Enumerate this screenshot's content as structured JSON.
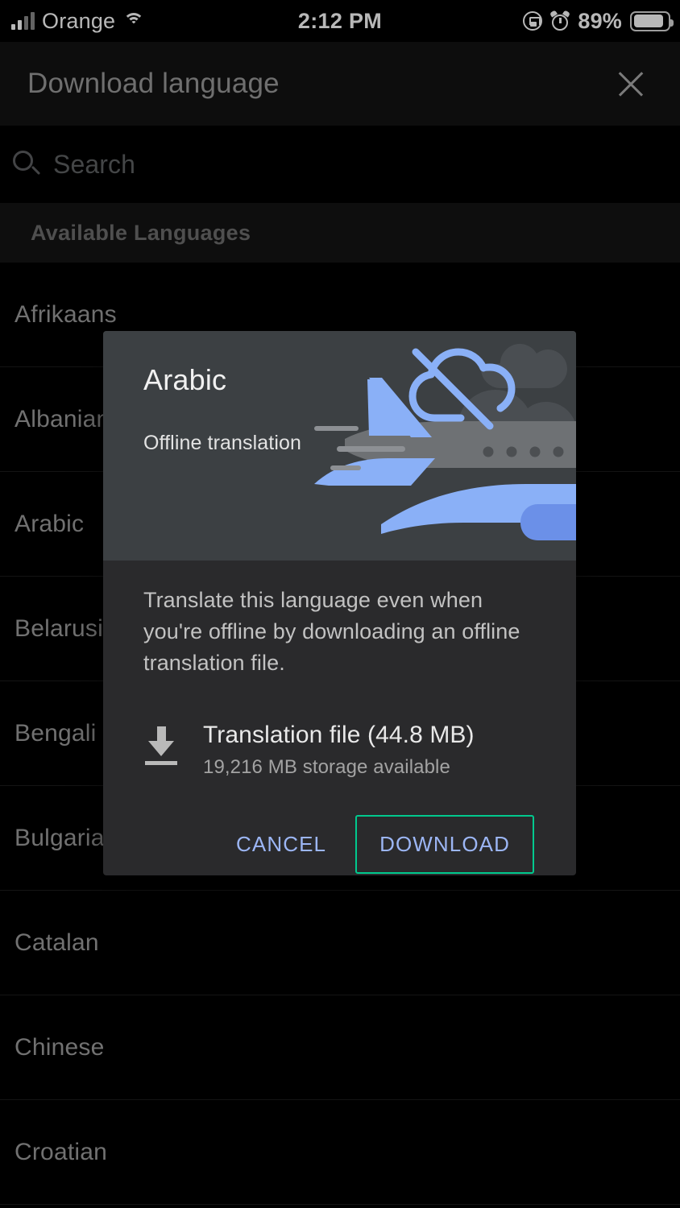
{
  "status_bar": {
    "carrier": "Orange",
    "signal_icon": "signal-bars-icon",
    "wifi_icon": "wifi-icon",
    "time": "2:12 PM",
    "rotation_lock_icon": "rotation-lock-icon",
    "alarm_icon": "alarm-clock-icon",
    "battery_percent": "89%",
    "battery_icon": "battery-icon",
    "battery_level": 89
  },
  "app_bar": {
    "title": "Download language",
    "close_icon": "close-icon"
  },
  "search": {
    "icon": "search-icon",
    "placeholder": "Search",
    "value": ""
  },
  "section": {
    "header": "Available Languages"
  },
  "languages": [
    {
      "name": "Afrikaans"
    },
    {
      "name": "Albanian"
    },
    {
      "name": "Arabic"
    },
    {
      "name": "Belarusian"
    },
    {
      "name": "Bengali"
    },
    {
      "name": "Bulgarian"
    },
    {
      "name": "Catalan"
    },
    {
      "name": "Chinese"
    },
    {
      "name": "Croatian"
    }
  ],
  "dialog": {
    "title": "Arabic",
    "subtitle": "Offline translation",
    "hero_icon": "cloud-off-icon",
    "hero_illustration": "airplane-illustration",
    "description": "Translate this language even when you're offline by downloading an offline translation file.",
    "file": {
      "icon": "download-icon",
      "name": "Translation file (44.8 MB)",
      "storage": "19,216 MB storage available"
    },
    "buttons": {
      "cancel": "CANCEL",
      "download": "DOWNLOAD"
    }
  },
  "colors": {
    "background": "#000000",
    "app_bar": "#121212",
    "section_header_bg": "#141414",
    "dialog_body": "#2a2a2c",
    "dialog_hero": "#3c4043",
    "accent_blue": "#9cb6f5",
    "focus_green": "#00c98e",
    "plane_blue": "#8ab0f7",
    "plane_gray": "#6e7174"
  }
}
